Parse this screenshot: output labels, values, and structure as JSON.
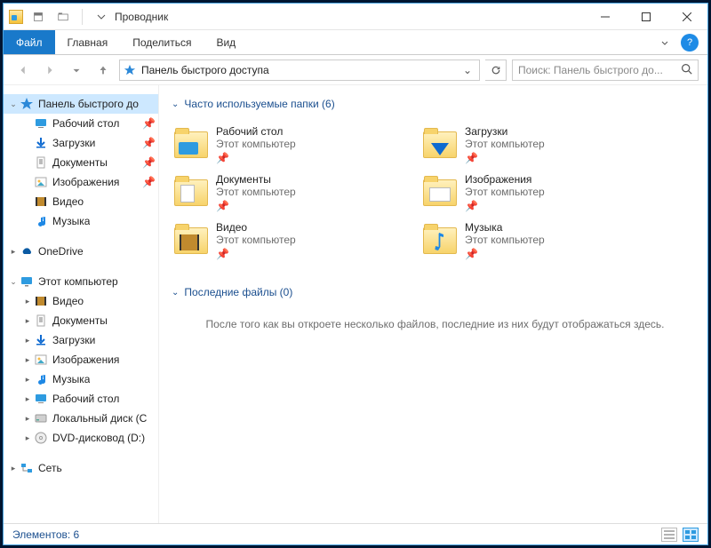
{
  "title": "Проводник",
  "ribbon": {
    "file": "Файл",
    "home": "Главная",
    "share": "Поделиться",
    "view": "Вид"
  },
  "address": {
    "path": "Панель быстрого доступа"
  },
  "search": {
    "placeholder": "Поиск: Панель быстрого до..."
  },
  "sidebar": {
    "quick": {
      "label": "Панель быстрого до",
      "items": [
        {
          "label": "Рабочий стол",
          "icon": "desktop",
          "pin": true
        },
        {
          "label": "Загрузки",
          "icon": "downloads",
          "pin": true
        },
        {
          "label": "Документы",
          "icon": "documents",
          "pin": true
        },
        {
          "label": "Изображения",
          "icon": "pictures",
          "pin": true
        },
        {
          "label": "Видео",
          "icon": "video",
          "pin": false
        },
        {
          "label": "Музыка",
          "icon": "music",
          "pin": false
        }
      ]
    },
    "onedrive": {
      "label": "OneDrive"
    },
    "thispc": {
      "label": "Этот компьютер",
      "items": [
        {
          "label": "Видео",
          "icon": "video"
        },
        {
          "label": "Документы",
          "icon": "documents"
        },
        {
          "label": "Загрузки",
          "icon": "downloads"
        },
        {
          "label": "Изображения",
          "icon": "pictures"
        },
        {
          "label": "Музыка",
          "icon": "music"
        },
        {
          "label": "Рабочий стол",
          "icon": "desktop"
        },
        {
          "label": "Локальный диск (C",
          "icon": "disk"
        },
        {
          "label": "DVD-дисковод (D:)",
          "icon": "dvd"
        }
      ]
    },
    "network": {
      "label": "Сеть"
    }
  },
  "groups": {
    "freq": {
      "header": "Часто используемые папки (6)",
      "items": [
        {
          "title": "Рабочий стол",
          "sub": "Этот компьютер",
          "ov": "desktop"
        },
        {
          "title": "Загрузки",
          "sub": "Этот компьютер",
          "ov": "download"
        },
        {
          "title": "Документы",
          "sub": "Этот компьютер",
          "ov": "doc"
        },
        {
          "title": "Изображения",
          "sub": "Этот компьютер",
          "ov": "pic"
        },
        {
          "title": "Видео",
          "sub": "Этот компьютер",
          "ov": "vid"
        },
        {
          "title": "Музыка",
          "sub": "Этот компьютер",
          "ov": "music"
        }
      ]
    },
    "recent": {
      "header": "Последние файлы (0)",
      "empty": "После того как вы откроете несколько файлов, последние из них будут отображаться здесь."
    }
  },
  "status": {
    "text": "Элементов: 6"
  }
}
